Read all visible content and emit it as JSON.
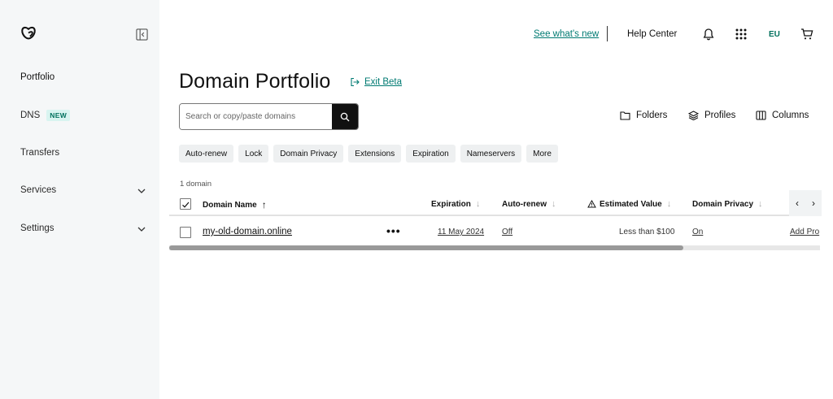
{
  "sidebar": {
    "items": [
      {
        "label": "Portfolio"
      },
      {
        "label": "DNS",
        "badge": "NEW"
      },
      {
        "label": "Transfers"
      },
      {
        "label": "Services"
      },
      {
        "label": "Settings"
      }
    ]
  },
  "topbar": {
    "whats_new": "See what's new",
    "help_center": "Help Center",
    "region": "EU"
  },
  "page": {
    "title": "Domain Portfolio",
    "exit_beta": "Exit Beta"
  },
  "search": {
    "placeholder": "Search or copy/paste domains"
  },
  "toolbar": {
    "folders": "Folders",
    "profiles": "Profiles",
    "columns": "Columns"
  },
  "filters": [
    "Auto-renew",
    "Lock",
    "Domain Privacy",
    "Extensions",
    "Expiration",
    "Nameservers",
    "More"
  ],
  "table": {
    "count": "1 domain",
    "headers": {
      "domain_name": "Domain Name",
      "expiration": "Expiration",
      "auto_renew": "Auto-renew",
      "estimated_value": "Estimated Value",
      "domain_privacy": "Domain Privacy"
    },
    "rows": [
      {
        "domain": "my-old-domain.online",
        "actions": "•••",
        "expiration": "11 May 2024",
        "auto_renew": "Off",
        "estimated_value": "Less than $100",
        "domain_privacy": "On",
        "next_col": "Add Pro"
      }
    ],
    "scroll_fraction": 0.79
  },
  "colors": {
    "accent_teal": "#007a72",
    "sidebar_bg": "#f5f7f8",
    "badge_bg": "#d8f4f0"
  }
}
